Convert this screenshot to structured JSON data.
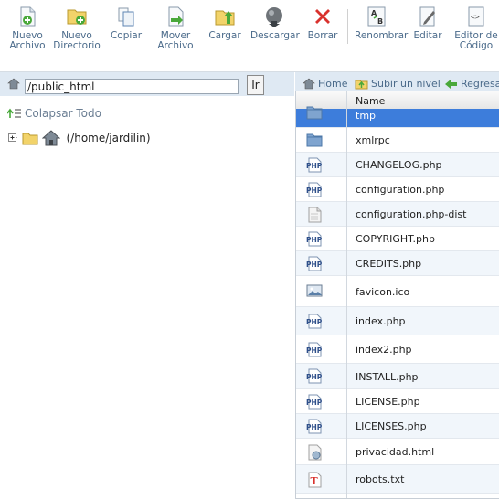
{
  "toolbar": {
    "new_file": "Nuevo\nArchivo",
    "new_folder": "Nuevo\nDirectorio",
    "copy": "Copiar",
    "move": "Mover\nArchivo",
    "upload": "Cargar",
    "download": "Descargar",
    "delete": "Borrar",
    "rename": "Renombrar",
    "edit": "Editar",
    "code_editor": "Editor de\nCódigo"
  },
  "path": {
    "value": "/public_html",
    "go": "Ir"
  },
  "tree": {
    "collapse_all": "Colapsar Todo",
    "root_label": "(/home/jardilin)"
  },
  "nav": {
    "home": "Home",
    "up_level": "Subir un nivel",
    "back": "Regresar"
  },
  "files": {
    "header_name": "Name",
    "rows": [
      {
        "name": "tmp",
        "icon": "folder-icon"
      },
      {
        "name": "xmlrpc",
        "icon": "folder-icon"
      },
      {
        "name": "CHANGELOG.php",
        "icon": "php-file-icon"
      },
      {
        "name": "configuration.php",
        "icon": "php-file-icon"
      },
      {
        "name": "configuration.php-dist",
        "icon": "generic-file-icon"
      },
      {
        "name": "COPYRIGHT.php",
        "icon": "php-file-icon"
      },
      {
        "name": "CREDITS.php",
        "icon": "php-file-icon"
      },
      {
        "name": "favicon.ico",
        "icon": "image-file-icon"
      },
      {
        "name": "index.php",
        "icon": "php-file-icon"
      },
      {
        "name": "index2.php",
        "icon": "php-file-icon"
      },
      {
        "name": "INSTALL.php",
        "icon": "php-file-icon"
      },
      {
        "name": "LICENSE.php",
        "icon": "php-file-icon"
      },
      {
        "name": "LICENSES.php",
        "icon": "php-file-icon"
      },
      {
        "name": "privacidad.html",
        "icon": "html-file-icon"
      },
      {
        "name": "robots.txt",
        "icon": "text-file-icon"
      }
    ]
  },
  "colors": {
    "selected_row": "#3d7ddb",
    "alt_row": "#f1f6fb",
    "bar_bg": "#dfe9f3",
    "link": "#4a6a8a"
  }
}
